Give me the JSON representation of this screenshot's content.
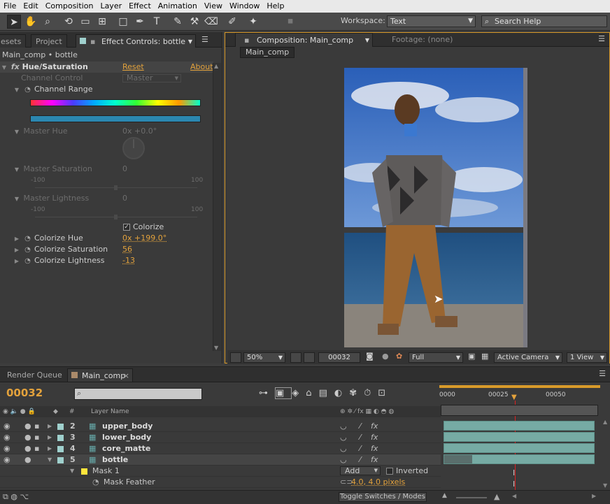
{
  "menu": [
    "File",
    "Edit",
    "Composition",
    "Layer",
    "Effect",
    "Animation",
    "View",
    "Window",
    "Help"
  ],
  "toolbar": {
    "workspace_label": "Workspace:",
    "workspace_value": "Text",
    "search_placeholder": "Search Help"
  },
  "left_panel": {
    "tabs": [
      "esets",
      "Project",
      "Effect Controls: bottle"
    ],
    "breadcrumb": "Main_comp • bottle",
    "effect": {
      "name": "Hue/Saturation",
      "reset": "Reset",
      "about": "About"
    },
    "channel_control": {
      "label": "Channel Control",
      "value": "Master"
    },
    "channel_range": "Channel Range",
    "master_hue": {
      "label": "Master Hue",
      "value": "0x +0.0°"
    },
    "master_saturation": {
      "label": "Master Saturation",
      "value": "0",
      "min": "-100",
      "max": "100"
    },
    "master_lightness": {
      "label": "Master Lightness",
      "value": "0",
      "min": "-100",
      "max": "100"
    },
    "colorize": {
      "label": "Colorize",
      "checked": true
    },
    "colorize_hue": {
      "label": "Colorize Hue",
      "value": "0x +199.0°"
    },
    "colorize_saturation": {
      "label": "Colorize Saturation",
      "value": "56"
    },
    "colorize_lightness": {
      "label": "Colorize Lightness",
      "value": "-13"
    }
  },
  "comp_panel": {
    "tabs": [
      "Composition: Main_comp",
      "Footage: (none)"
    ],
    "breadcrumb": "Main_comp",
    "zoom": "50%",
    "timecode": "00032",
    "resolution": "Full",
    "camera": "Active Camera",
    "views": "1 View"
  },
  "timeline": {
    "tabs": [
      "Render Queue",
      "Main_comp"
    ],
    "current_time": "00032",
    "ruler": [
      "0000",
      "00025",
      "00050"
    ],
    "col_num": "#",
    "col_name": "Layer Name",
    "layers": [
      {
        "num": "2",
        "name": "upper_body",
        "color": "#9fd0cd"
      },
      {
        "num": "3",
        "name": "lower_body",
        "color": "#9fd0cd"
      },
      {
        "num": "4",
        "name": "core_matte",
        "color": "#9fd0cd"
      },
      {
        "num": "5",
        "name": "bottle",
        "color": "#9fd0cd"
      }
    ],
    "mask": {
      "name": "Mask 1",
      "mode": "Add",
      "inverted": "Inverted",
      "feather_label": "Mask Feather",
      "feather_value": "4.0, 4.0 pixels"
    },
    "toggle_label": "Toggle Switches / Modes"
  },
  "colors": {
    "accent": "#e3a23c",
    "track": "#76aba4",
    "playhead": "#d22"
  }
}
